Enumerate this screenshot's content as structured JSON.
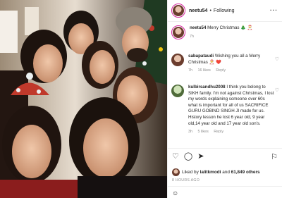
{
  "post": {
    "username": "neetu54",
    "separator": "•",
    "follow_label": "Following",
    "more_label": "···",
    "caption_text": "Merry Christmas",
    "caption_emoji": "🎄 🎅",
    "caption_time": "7h"
  },
  "comments": [
    {
      "username": "sabapataudi",
      "text": "Wishing you all a Merry Christmas 🎅 ❤️",
      "time": "7h",
      "likes": "16 likes",
      "reply": "Reply"
    },
    {
      "username": "kulbirsandhu2008",
      "text": "I think you belong to SIKH family. I'm not against Christmas, I lost my words explaining someone over 60s what is important for all of us SACRIFICE GURU GOBIND SINGH JI made for us. History lesson he lost 6 year old, 9 year old,14 year old and 17 year old son's.",
      "time": "3h",
      "likes": "5 likes",
      "reply": "Reply"
    }
  ],
  "actions": {
    "like_icon": "heart-icon",
    "comment_icon": "comment-icon",
    "share_icon": "share-icon",
    "save_icon": "bookmark-icon"
  },
  "likes": {
    "prefix": "Liked by",
    "user": "lalitkmodi",
    "middle": "and",
    "count": "61,849 others"
  },
  "timestamp": "8 HOURS AGO",
  "add_comment_icon": "smile-icon",
  "colors": {
    "ring": "#d6249f",
    "muted": "#8e8e8e",
    "text": "#262626"
  }
}
